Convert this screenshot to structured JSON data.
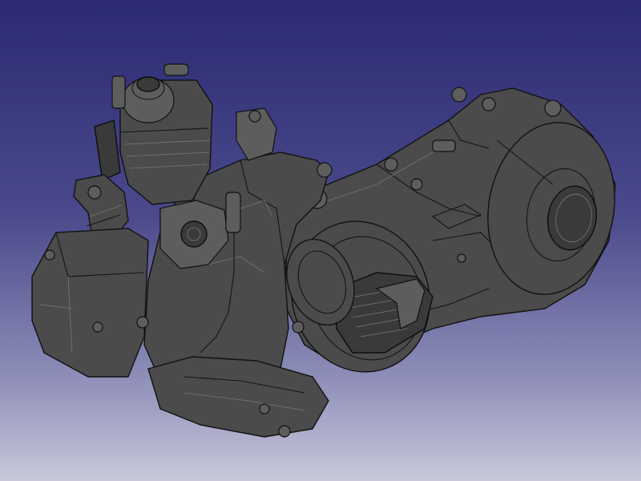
{
  "viewport": {
    "background_top": "#2b2a73",
    "background_bottom": "#c8c8da",
    "model_color": "#4b4b4b",
    "edge_color": "#111111"
  },
  "model": {
    "icon": "scooter-engine-3d-model"
  }
}
